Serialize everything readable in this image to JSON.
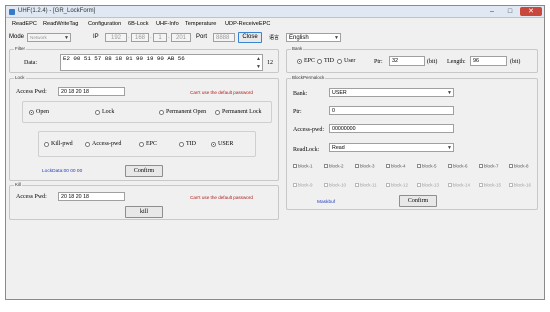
{
  "title": "UHF(1.2.4) - [GR_LockForm]",
  "window_controls": {
    "minimize": "–",
    "maximize": "□",
    "close": "✕"
  },
  "menu": [
    "ReadEPC",
    "ReadWriteTag",
    "Configuration",
    "6B-Lock",
    "UHF-Info",
    "Temperature",
    "UDP-ReceiveEPC"
  ],
  "toolbar": {
    "mode_label": "Mode",
    "mode_value": "Network",
    "ip_label": "IP",
    "ip_octets": [
      "192",
      "168",
      "1",
      "201"
    ],
    "port_label": "Port",
    "port_value": "8888",
    "close_button": "Close",
    "lang_label": "语言",
    "lang_value": "English"
  },
  "filter": {
    "title": "Filter",
    "data_label": "Data:",
    "data_value": "E2 00 51 57 88 18 01 90 19 90 AB 56",
    "length_hint": "12"
  },
  "bank": {
    "title": "Bank",
    "options": [
      "EPC",
      "TID",
      "User"
    ],
    "selected": "EPC",
    "ptr_label": "Ptr:",
    "ptr_value": "32",
    "ptr_unit": "(bit)",
    "length_label": "Length:",
    "length_value": "96",
    "length_unit": "(bit)"
  },
  "lock": {
    "title": "Lock",
    "pwd_label": "Access Pwd:",
    "pwd_value": "20 18 20 18",
    "pwd_note": "Can't use the default password",
    "modes": [
      "Open",
      "Lock",
      "Permanent Open",
      "Permanent Lock"
    ],
    "mode_selected": "Open",
    "areas": [
      "Kill-pwd",
      "Access-pwd",
      "EPC",
      "TID",
      "USER"
    ],
    "area_selected": "USER",
    "lockdata": "LockData:00 00 00",
    "confirm": "Confirm"
  },
  "kill": {
    "title": "Kill",
    "pwd_label": "Access Pwd:",
    "pwd_value": "20 18 20 18",
    "pwd_note": "Can't use the default password",
    "button": "kill"
  },
  "blockpermalock": {
    "title": "BlockPermalock",
    "bank_label": "Bank:",
    "bank_value": "USER",
    "ptr_label": "Ptr:",
    "ptr_value": "0",
    "pwd_label": "Access-pwd:",
    "pwd_value": "00000000",
    "readlock_label": "ReadLock:",
    "readlock_value": "Read",
    "blocks_row1": [
      "block-1",
      "block-2",
      "block-3",
      "block-4",
      "block-5",
      "block-6",
      "block-7",
      "block-8"
    ],
    "blocks_row2": [
      "block-9",
      "block-10",
      "block-11",
      "block-12",
      "block-13",
      "block-14",
      "block-15",
      "block-16"
    ],
    "maskbuf": "Maskbuf",
    "confirm": "Confirm"
  }
}
